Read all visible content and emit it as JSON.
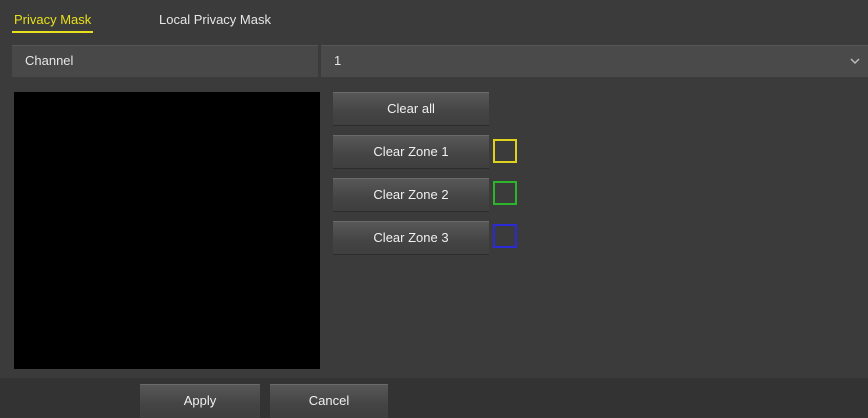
{
  "tabs": [
    {
      "label": "Privacy Mask",
      "active": true
    },
    {
      "label": "Local Privacy Mask",
      "active": false
    }
  ],
  "channel": {
    "label": "Channel",
    "selected_value": "1"
  },
  "icons": {
    "select_arrow": "chevron-down-icon"
  },
  "buttons": {
    "clear_all": "Clear all",
    "clear_zone_1": "Clear Zone 1",
    "clear_zone_2": "Clear Zone 2",
    "clear_zone_3": "Clear Zone 3",
    "apply": "Apply",
    "cancel": "Cancel"
  },
  "zone_colors": {
    "zone1": "#e0d21c",
    "zone2": "#2bb52b",
    "zone3": "#2a2ad6"
  },
  "colors": {
    "accent": "#e8e01a",
    "background": "#3b3b3b",
    "preview": "#000000"
  }
}
